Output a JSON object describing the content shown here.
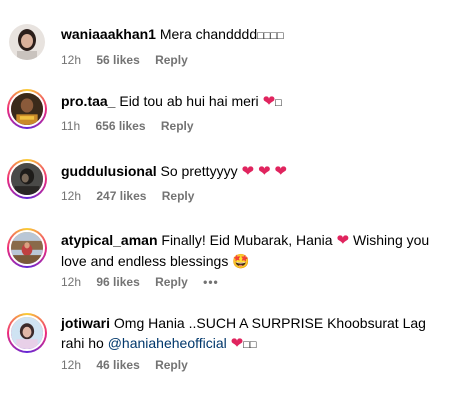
{
  "comments": [
    {
      "username": "waniaaakhan1",
      "text": "Mera chandddd",
      "trailing": "□□□□",
      "time": "12h",
      "likes": "56 likes",
      "reply": "Reply"
    },
    {
      "username": "pro.taa_",
      "text": "Eid tou ab hui hai meri",
      "heart": "❤",
      "trailing": "□",
      "time": "11h",
      "likes": "656 likes",
      "reply": "Reply"
    },
    {
      "username": "guddulusional",
      "text": "So prettyyyy",
      "hearts": [
        "❤",
        "❤",
        "❤"
      ],
      "time": "12h",
      "likes": "247 likes",
      "reply": "Reply"
    },
    {
      "username": "atypical_aman",
      "text": "Finally! Eid Mubarak, Hania",
      "heart": "❤",
      "text2": "Wishing you love and endless blessings",
      "emoji": "🤩",
      "time": "12h",
      "likes": "96 likes",
      "reply": "Reply",
      "more": "•••"
    },
    {
      "username": "jotiwari",
      "text": "Omg Hania ..SUCH A SURPRISE Khoobsurat Lag rahi ho",
      "mention": "@haniaheheofficial",
      "heart": "❤",
      "trailing": "□□",
      "time": "12h",
      "likes": "46 likes",
      "reply": "Reply"
    }
  ],
  "colors": {
    "meta": "#737373",
    "mention": "#00376b",
    "heart": "#e0245e"
  }
}
